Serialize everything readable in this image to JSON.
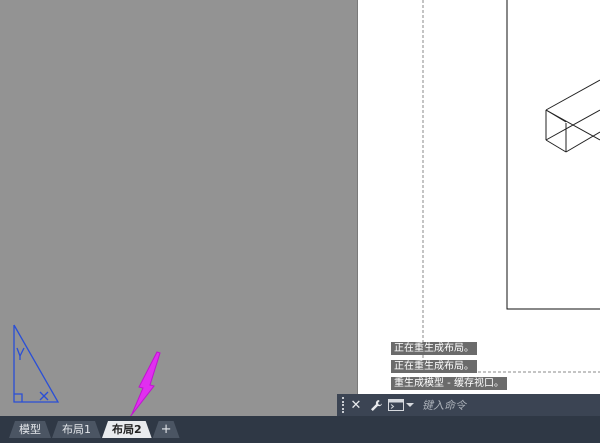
{
  "console": {
    "lines": [
      "正在重生成布局。",
      "正在重生成布局。",
      "重生成模型 - 缓存视口。"
    ]
  },
  "command_bar": {
    "placeholder": "键入命令",
    "icons": [
      "close-icon",
      "wrench-icon",
      "command-prompt-icon",
      "chevron-down-icon"
    ]
  },
  "layout_tabs": {
    "items": [
      {
        "label": "模型",
        "active": false
      },
      {
        "label": "布局1",
        "active": false
      },
      {
        "label": "布局2",
        "active": true
      }
    ],
    "add_label": "+"
  },
  "colors": {
    "model_space": "#939393",
    "paper": "#ffffff",
    "tab_bar": "#2f3845",
    "ucs_icon": "#2a4fd6",
    "annotation_arrow": "#e12ff0"
  }
}
